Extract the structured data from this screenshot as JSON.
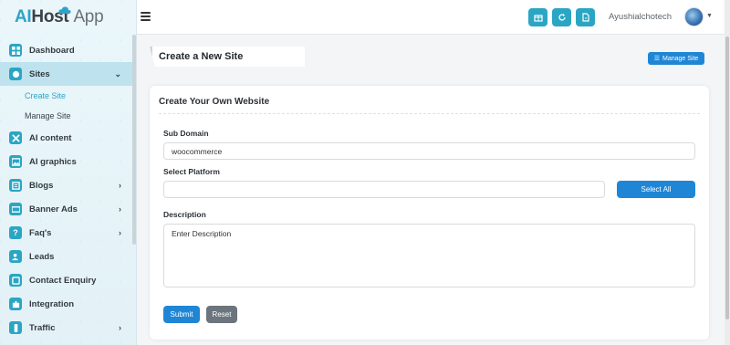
{
  "brand": {
    "logo_ai": "AI",
    "logo_host": "Host",
    "logo_app": "App"
  },
  "sidebar": {
    "items": [
      {
        "label": "Dashboard",
        "icon": "dashboard-icon"
      },
      {
        "label": "Sites",
        "icon": "sites-icon",
        "active": true
      },
      {
        "label": "AI content",
        "icon": "ai-content-icon"
      },
      {
        "label": "AI graphics",
        "icon": "image-icon"
      },
      {
        "label": "Blogs",
        "icon": "blog-icon"
      },
      {
        "label": "Banner Ads",
        "icon": "banner-icon"
      },
      {
        "label": "Faq's",
        "icon": "question-icon"
      },
      {
        "label": "Leads",
        "icon": "user-plus-icon"
      },
      {
        "label": "Contact Enquiry",
        "icon": "contact-icon"
      },
      {
        "label": "Integration",
        "icon": "puzzle-icon"
      },
      {
        "label": "Traffic",
        "icon": "traffic-icon"
      }
    ],
    "sites_sub": [
      {
        "label": "Create Site",
        "active": true
      },
      {
        "label": "Manage Site"
      }
    ]
  },
  "topbar": {
    "user_name": "Ayushialchotech",
    "buttons": [
      "gift-icon",
      "refresh-icon",
      "document-icon"
    ]
  },
  "page": {
    "title": "Create a New Site",
    "manage_button": "Manage Site"
  },
  "form": {
    "card_title": "Create Your Own Website",
    "subdomain_label": "Sub Domain",
    "subdomain_value": "woocommerce",
    "platform_label": "Select Platform",
    "platform_value": "",
    "select_all_label": "Select All",
    "description_label": "Description",
    "description_placeholder": "Enter Description",
    "submit_label": "Submit",
    "reset_label": "Reset"
  },
  "colors": {
    "accent": "#2aa6c4",
    "primary_button": "#1f86d6",
    "secondary_button": "#6c757d",
    "sidebar_active": "#bfe3ee"
  }
}
